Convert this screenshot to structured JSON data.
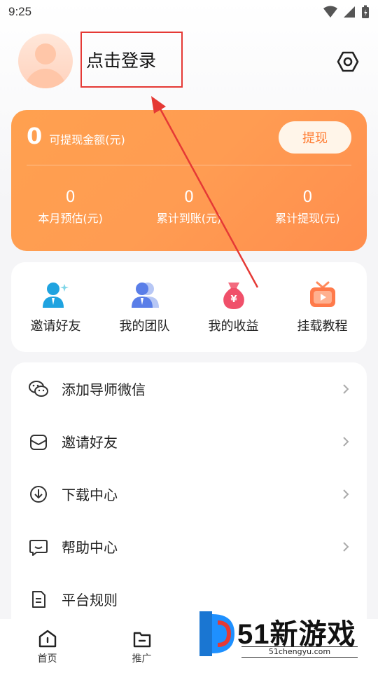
{
  "status_bar": {
    "time": "9:25"
  },
  "profile": {
    "login_text": "点击登录"
  },
  "earnings": {
    "balance_value": "0",
    "balance_label": "可提现金额(元)",
    "withdraw_label": "提现",
    "stats": [
      {
        "value": "0",
        "label": "本月预估(元)"
      },
      {
        "value": "0",
        "label": "累计到账(元)"
      },
      {
        "value": "0",
        "label": "累计提现(元)"
      }
    ]
  },
  "quick_actions": [
    {
      "label": "邀请好友",
      "icon": "invite-user-icon"
    },
    {
      "label": "我的团队",
      "icon": "team-icon"
    },
    {
      "label": "我的收益",
      "icon": "money-bag-icon"
    },
    {
      "label": "挂载教程",
      "icon": "tv-play-icon"
    }
  ],
  "menu": [
    {
      "label": "添加导师微信",
      "icon": "wechat-icon"
    },
    {
      "label": "邀请好友",
      "icon": "envelope-icon"
    },
    {
      "label": "下载中心",
      "icon": "download-icon"
    },
    {
      "label": "帮助中心",
      "icon": "chat-help-icon"
    },
    {
      "label": "平台规则",
      "icon": "document-icon"
    }
  ],
  "tabs": [
    {
      "label": "首页",
      "icon": "home-icon"
    },
    {
      "label": "推广",
      "icon": "folder-icon"
    }
  ],
  "watermark": {
    "brand": "51新游戏",
    "url": "51chengyu.com"
  },
  "colors": {
    "accent": "#ff9a50",
    "annotation": "#e53935"
  }
}
